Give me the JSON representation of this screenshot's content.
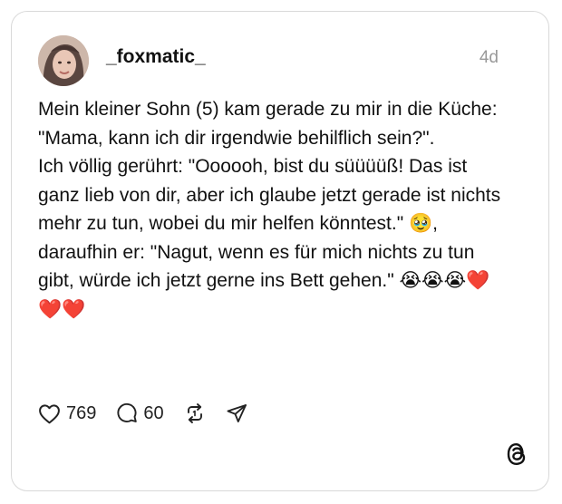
{
  "post": {
    "username": "_foxmatic_",
    "time": "4d",
    "text": "Mein kleiner Sohn (5) kam gerade zu mir in die Küche: \"Mama, kann ich dir irgendwie behilflich sein?\".\nIch völlig gerührt: \"Oooooh, bist du süüüüß! Das ist ganz lieb von dir, aber ich glaube jetzt gerade ist nichts mehr zu tun, wobei du mir helfen könntest.\" 🥹,\ndaraufhin er: \"Nagut, wenn es für mich nichts zu tun gibt, würde ich jetzt gerne ins Bett gehen.\" 😭😭😭❤️❤️❤️",
    "likes": "769",
    "comments": "60"
  },
  "icons": {
    "like": "heart-icon",
    "comment": "speech-bubble-icon",
    "repost": "repost-icon",
    "share": "send-icon",
    "brand": "threads-logo-icon"
  }
}
